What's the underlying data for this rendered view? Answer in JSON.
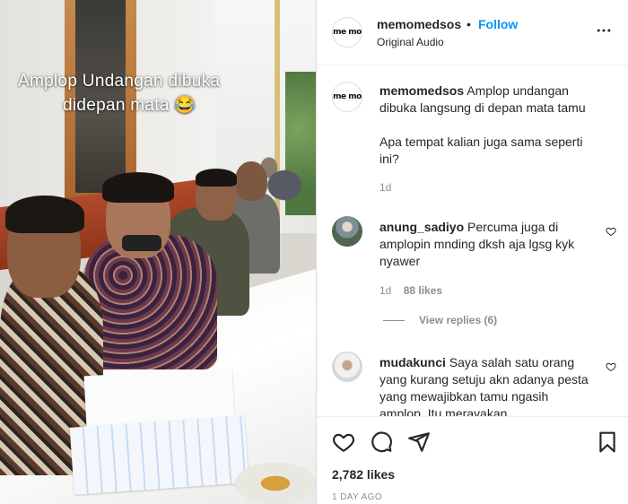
{
  "video": {
    "overlay_line1": "Amplop Undangan dibuka",
    "overlay_line2": "didepan mata 😂"
  },
  "header": {
    "username": "memomedsos",
    "separator": "•",
    "follow_label": "Follow",
    "audio_label": "Original Audio",
    "avatar_logo": "me mo",
    "more_icon": "more-horizontal-icon"
  },
  "caption": {
    "username": "memomedsos",
    "text_line1": "Amplop undangan dibuka langsung di depan mata tamu",
    "text_line2": "Apa tempat kalian juga sama seperti ini?",
    "time": "1d"
  },
  "comments": [
    {
      "username": "anung_sadiyo",
      "text": "Percuma juga di amplopin mnding dksh aja lgsg kyk nyawer",
      "time": "1d",
      "likes": "88 likes",
      "view_replies": "View replies (6)"
    },
    {
      "username": "mudakunci",
      "text": "Saya salah satu orang yang kurang setuju akn adanya pesta yang mewajibkan tamu ngasih amplop. Itu merayakan"
    }
  ],
  "actions": {
    "like_icon": "heart-icon",
    "comment_icon": "comment-icon",
    "share_icon": "send-icon",
    "save_icon": "bookmark-icon",
    "likes_count": "2,782 likes",
    "timestamp": "1 DAY AGO"
  },
  "colors": {
    "accent": "#0095f6",
    "text": "#262626",
    "muted": "#8e8e8e",
    "border": "#dbdbdb"
  }
}
